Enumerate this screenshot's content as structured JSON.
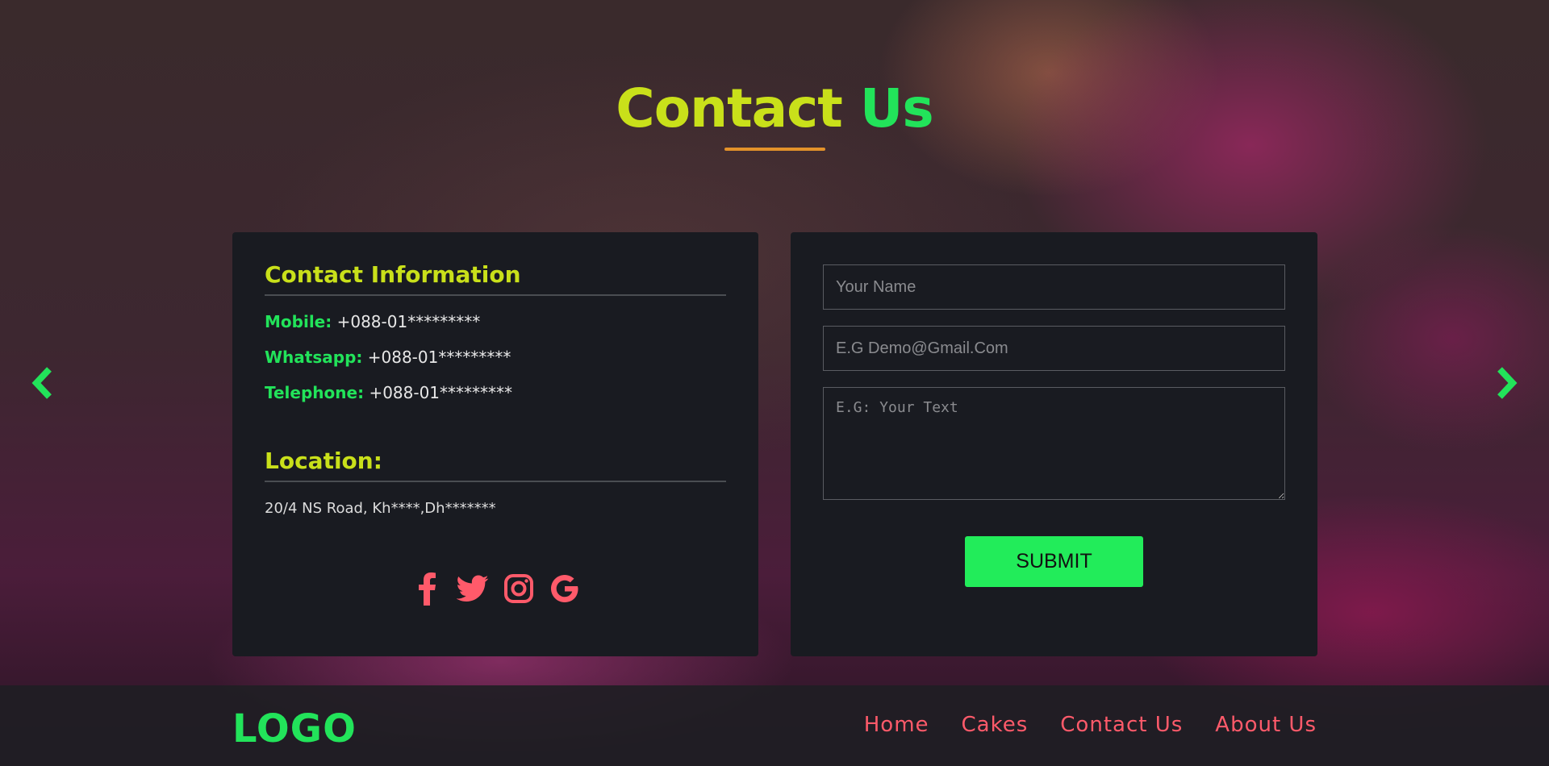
{
  "heading": {
    "word1": "Contact",
    "word2": "Us"
  },
  "colors": {
    "accent_yellow": "#c9e01a",
    "accent_green": "#22e35a",
    "underline": "#e3922a",
    "nav_red": "#ff5a6a",
    "card_bg": "#191b21"
  },
  "carousel": {
    "prev_icon": "chevron-left-icon",
    "next_icon": "chevron-right-icon"
  },
  "contact_info": {
    "title": "Contact Information",
    "lines": [
      {
        "label": "Mobile:",
        "value": "+088-01*********"
      },
      {
        "label": "Whatsapp:",
        "value": "+088-01*********"
      },
      {
        "label": "Telephone:",
        "value": "+088-01*********"
      }
    ],
    "location_title": "Location:",
    "address": "20/4 NS Road, Kh****,Dh*******",
    "socials": [
      "facebook-icon",
      "twitter-icon",
      "instagram-icon",
      "google-icon"
    ]
  },
  "form": {
    "name_placeholder": "Your Name",
    "email_placeholder": "E.G Demo@Gmail.Com",
    "message_placeholder": "E.G: Your Text",
    "submit_label": "SUBMIT"
  },
  "footer": {
    "logo": "LOGO",
    "nav": [
      "Home",
      "Cakes",
      "Contact Us",
      "About Us"
    ]
  }
}
